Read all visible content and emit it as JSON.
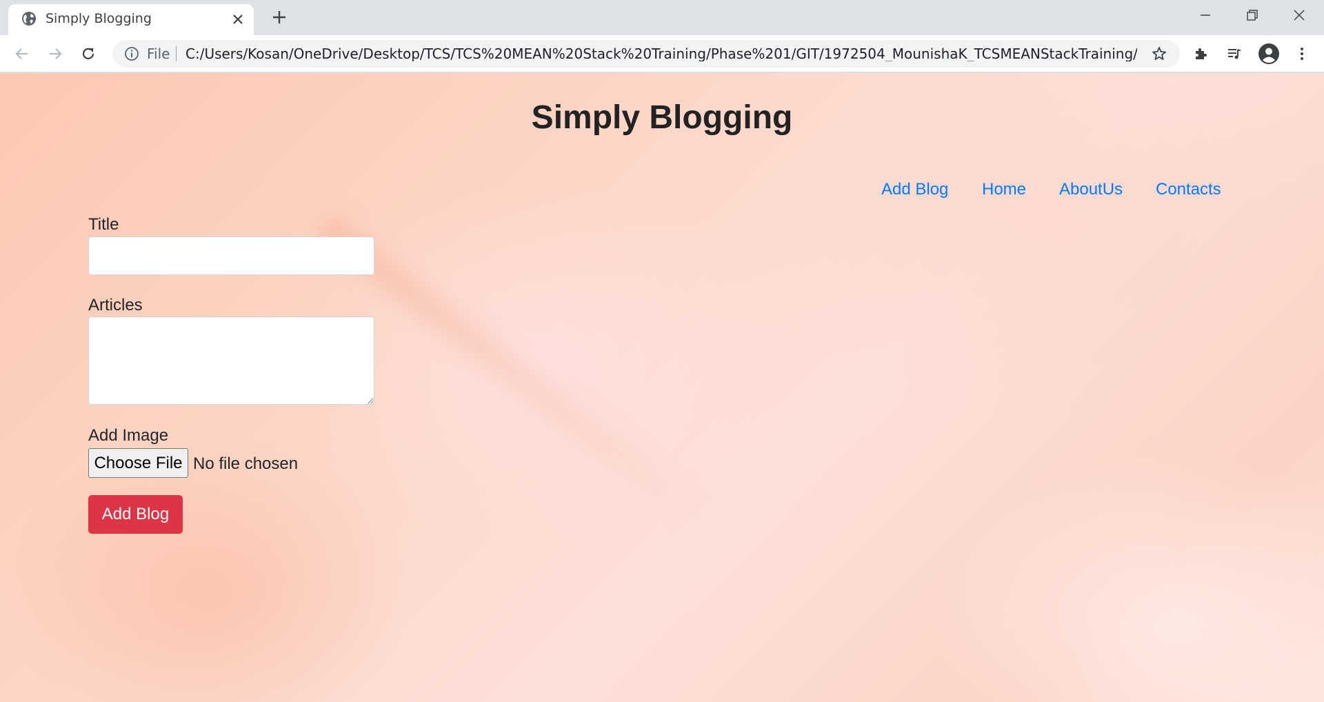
{
  "browser": {
    "tab": {
      "title": "Simply Blogging",
      "favicon": "globe-icon"
    },
    "address_bar": {
      "scheme_label": "File",
      "url": "C:/Users/Kosan/OneDrive/Desktop/TCS/TCS%20MEAN%20Stack%20Training/Phase%201/GIT/1972504_MounishaK_TCSMEANStackTraining/SimplyB..."
    },
    "icons": [
      "back-arrow-icon",
      "forward-arrow-icon",
      "reload-icon",
      "info-icon",
      "star-icon",
      "extensions-icon",
      "media-control-icon",
      "profile-icon",
      "more-menu-icon",
      "minimize-icon",
      "restore-icon",
      "close-icon",
      "new-tab-icon"
    ]
  },
  "page": {
    "title": "Simply Blogging",
    "nav": [
      {
        "label": "Add Blog"
      },
      {
        "label": "Home"
      },
      {
        "label": "AboutUs"
      },
      {
        "label": "Contacts"
      }
    ],
    "form": {
      "title_label": "Title",
      "title_value": "",
      "articles_label": "Articles",
      "articles_value": "",
      "image_label": "Add Image",
      "choose_file_label": "Choose File",
      "no_file_text": "No file chosen",
      "submit_label": "Add Blog"
    }
  },
  "colors": {
    "link": "#007bff",
    "submit": "#dc3545",
    "background": "#fcd3c6"
  }
}
